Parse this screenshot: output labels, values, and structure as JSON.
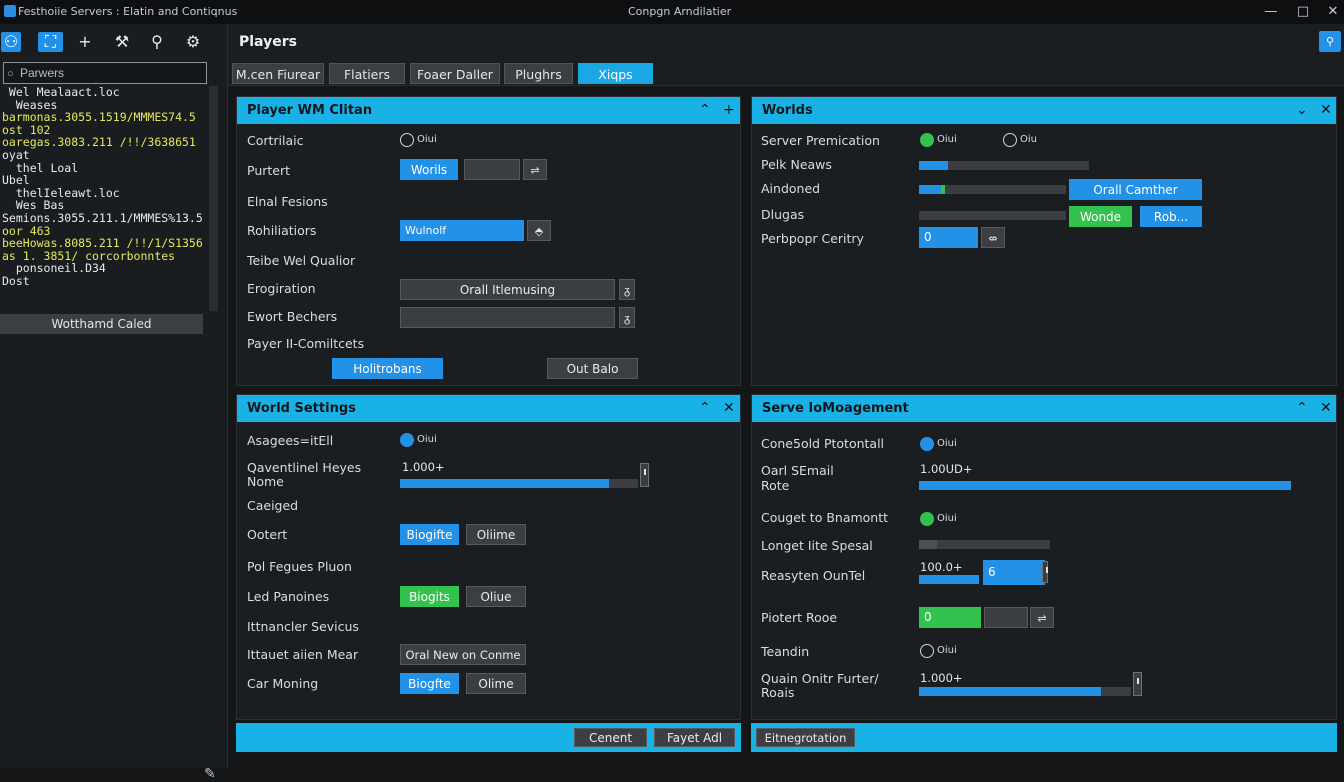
{
  "window": {
    "title": "Festhoiie Servers : Elatin and Contiqnus",
    "center_title": "Conpgn Arndilatier",
    "minimize": "—",
    "maximize": "□",
    "close": "✕"
  },
  "sidebar": {
    "search_placeholder": "Parwers",
    "console_lines": [
      {
        "text": " Wel Mealaact.loc",
        "color": "w"
      },
      {
        "text": "  Weases",
        "color": "w"
      },
      {
        "text": "barmonas.3055.1519/MMMES74.5",
        "color": "y"
      },
      {
        "text": "ost 102",
        "color": "y"
      },
      {
        "text": "oaregas.3083.211 /!!/3638651",
        "color": "y"
      },
      {
        "text": "oyat",
        "color": "w"
      },
      {
        "text": "  thel Loal",
        "color": "w"
      },
      {
        "text": "Ubel",
        "color": "w"
      },
      {
        "text": "  thelIeleawt.loc",
        "color": "w"
      },
      {
        "text": "  Wes Bas",
        "color": "w"
      },
      {
        "text": "Semions.3055.211.1/MMMES%13.5",
        "color": "w"
      },
      {
        "text": "oor 463",
        "color": "y"
      },
      {
        "text": "beeHowas.8085.211 /!!/1/S1356",
        "color": "y"
      },
      {
        "text": "as 1. 3851/ corcorbonntes",
        "color": "y"
      },
      {
        "text": "  ponsoneil.D34",
        "color": "w"
      },
      {
        "text": "Dost",
        "color": "w"
      }
    ],
    "footer_label": "Wotthamd Caled"
  },
  "main": {
    "title": "Players",
    "tabs": [
      "M.cen Fiurear",
      "Flatiers",
      "Foaer Daller",
      "Plughrs",
      "Xiqps"
    ],
    "player_panel": {
      "title": "Player WM Clitan",
      "rows": {
        "r1": "Cortrilaic",
        "r1_radio": "Oiui",
        "r2": "Purtert",
        "r2_btn": "Worils",
        "r2_sq": "⇌",
        "r3": "Elnal Fesions",
        "r4": "Rohiliatiors",
        "r4_input": "Wulnolf",
        "r4_sq": "⬘",
        "r5": "Teibe Wel Qualior",
        "r6": "Erogiration",
        "r6_btn": "Orall Itlemusing",
        "r6_sq": "ᵹ",
        "r7": "Ewort Bechers",
        "r7_sq": "ᵹ",
        "r8": "Payer II-Comiltcets",
        "btn_left": "Holitrobans",
        "btn_right": "Out Balo"
      }
    },
    "worlds_panel": {
      "title": "Worlds",
      "rows": {
        "r1": "Server Premication",
        "r1_radio_a": "Oiui",
        "r1_radio_b": "Oiu",
        "r2": "Pelk Neaws",
        "r2_fill": 0.17,
        "r3": "Aindoned",
        "r3_fill": 0.18,
        "r3_btn": "Orall Camther",
        "r4": "Dlugas",
        "r4_btn_green": "Wonde",
        "r4_btn_blue": "Rob...",
        "r5": "Perbpopr Ceritry",
        "r5_input": "0",
        "r5_sq": "⇎"
      }
    },
    "world_settings": {
      "title": "World Settings",
      "rows": {
        "r1": "Asagees=itEll",
        "r1_radio": "Oiui",
        "r2a": "Qaventlinel Heyes",
        "r2b": "Nome",
        "r2_value": "1.000+",
        "r2_fill": 0.88,
        "r3": "Caeiged",
        "r4": "Ootert",
        "r4_btn_a": "Biogifte",
        "r4_btn_b": "Oliime",
        "r5": "Pol Fegues Pluon",
        "r6": "Led Panoines",
        "r6_btn_a": "Biogits",
        "r6_btn_b": "Oliue",
        "r7": "Ittnancler Sevicus",
        "r8": "Ittauet aiien Mear",
        "r8_btn": "Oral New on Conme",
        "r9": "Car Moning",
        "r9_btn_a": "Biogfte",
        "r9_btn_b": "Olime"
      }
    },
    "serve_panel": {
      "title": "Serve IoMoagement",
      "rows": {
        "r1": "Cone5old Ptotontall",
        "r1_radio": "Oiui",
        "r2a": "Oarl SEmail",
        "r2b": "Rote",
        "r2_value": "1.00UD+",
        "r2_fill": 1.0,
        "r3": "Couget to Bnamontt",
        "r3_radio": "Oiui",
        "r4": "Longet Iite Spesal",
        "r4_fill": 0.14,
        "r5": "Reasyten OunTel",
        "r5_value": "100.0+",
        "r5_fill": 1.0,
        "r5_input": "6",
        "r6": "Piotert Rooe",
        "r6_input": "0",
        "r6_sq": "⇌",
        "r7": "Teandin",
        "r7_radio": "Oiui",
        "r8a": "Quain Onitr Furter/",
        "r8b": "Roais",
        "r8_value": "1.000+",
        "r8_fill": 0.86
      }
    },
    "footer": {
      "btn_a": "Cenent",
      "btn_b": "Fayet Adl",
      "btn_c": "Eitnegrotation"
    }
  }
}
